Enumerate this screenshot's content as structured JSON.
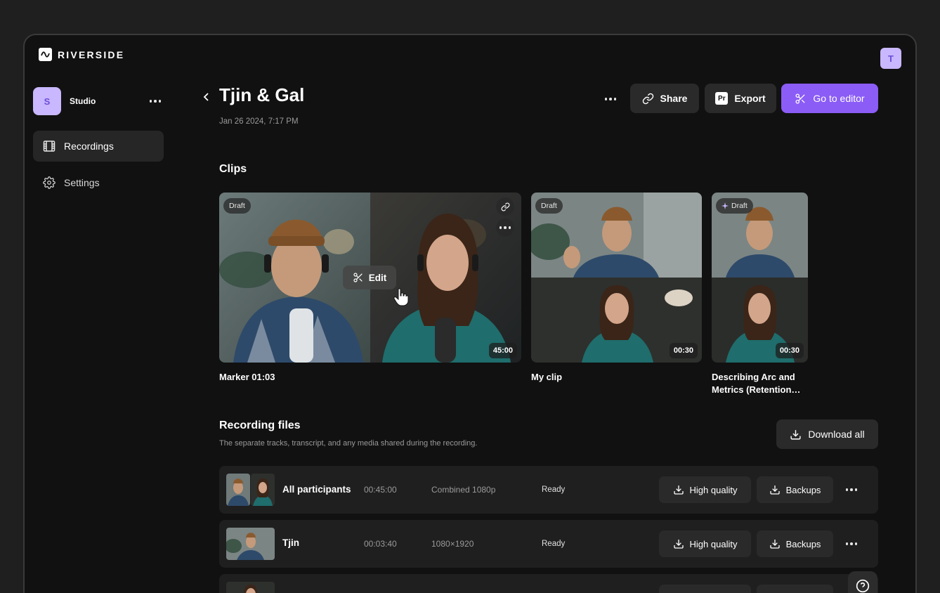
{
  "brand": {
    "name": "RIVERSIDE"
  },
  "user": {
    "initial": "T"
  },
  "sidebar": {
    "workspace": {
      "initial": "S",
      "name": "Studio"
    },
    "items": [
      {
        "label": "Recordings",
        "icon": "film-icon",
        "active": true
      },
      {
        "label": "Settings",
        "icon": "gear-icon",
        "active": false
      }
    ]
  },
  "header": {
    "title": "Tjin & Gal",
    "date": "Jan 26 2024, 7:17 PM",
    "share_label": "Share",
    "export_label": "Export",
    "export_icon_text": "Pr",
    "editor_label": "Go to editor"
  },
  "clips": {
    "title": "Clips",
    "edit_label": "Edit",
    "items": [
      {
        "name": "Marker 01:03",
        "badge": "Draft",
        "duration": "45:00"
      },
      {
        "name": "My clip",
        "badge": "Draft",
        "duration": "00:30"
      },
      {
        "name": "Describing Arc and Metrics (Retention…",
        "badge": "Draft",
        "duration": "00:30"
      }
    ]
  },
  "files": {
    "title": "Recording files",
    "subtitle": "The separate tracks, transcript, and any media shared during the recording.",
    "download_all_label": "Download all",
    "high_quality_label": "High quality",
    "backups_label": "Backups",
    "rows": [
      {
        "name": "All participants",
        "duration": "00:45:00",
        "resolution": "Combined 1080p",
        "status": "Ready"
      },
      {
        "name": "Tjin",
        "duration": "00:03:40",
        "resolution": "1080×1920",
        "status": "Ready"
      }
    ]
  },
  "colors": {
    "accent": "#8b5cf6",
    "avatar_bg": "#c9b7ff",
    "background": "#111111"
  }
}
